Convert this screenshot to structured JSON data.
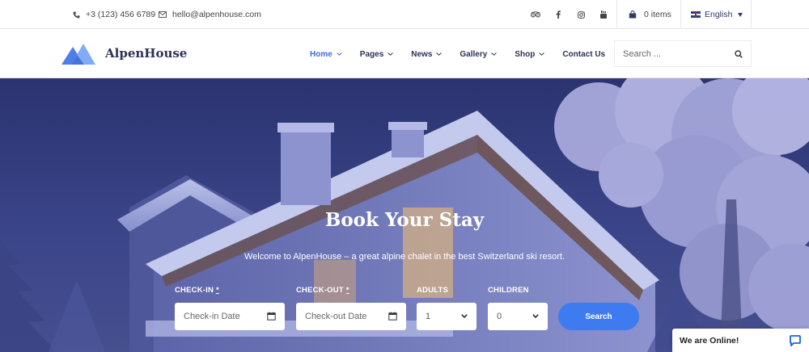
{
  "topbar": {
    "phone": "+3 (123) 456 6789",
    "email": "hello@alpenhouse.com",
    "socials": [
      "tripadvisor-icon",
      "facebook-icon",
      "instagram-icon",
      "youtube-icon"
    ],
    "cart_label": "0 items",
    "language": "English"
  },
  "header": {
    "brand": "AlpenHouse",
    "nav": [
      {
        "label": "Home",
        "has_dropdown": true,
        "active": true
      },
      {
        "label": "Pages",
        "has_dropdown": true
      },
      {
        "label": "News",
        "has_dropdown": true
      },
      {
        "label": "Gallery",
        "has_dropdown": true
      },
      {
        "label": "Shop",
        "has_dropdown": true
      },
      {
        "label": "Contact Us",
        "has_dropdown": false
      }
    ],
    "search_placeholder": "Search ..."
  },
  "hero": {
    "title": "Book Your Stay",
    "subtitle": "Welcome to AlpenHouse – a great alpine chalet in the best Switzerland ski resort.",
    "checkin_label": "CHECK-IN",
    "checkin_placeholder": "Check-in Date",
    "checkout_label": "CHECK-OUT",
    "checkout_placeholder": "Check-out Date",
    "required_mark": "*",
    "adults_label": "ADULTS",
    "adults_value": "1",
    "children_label": "CHILDREN",
    "children_value": "0",
    "search_button": "Search"
  },
  "chat": {
    "label": "We are Online!"
  },
  "colors": {
    "accent": "#3e7bf0",
    "nav_active": "#3f6fd1",
    "brand_dark": "#2a3356",
    "hero_bg": "#323c7c"
  }
}
